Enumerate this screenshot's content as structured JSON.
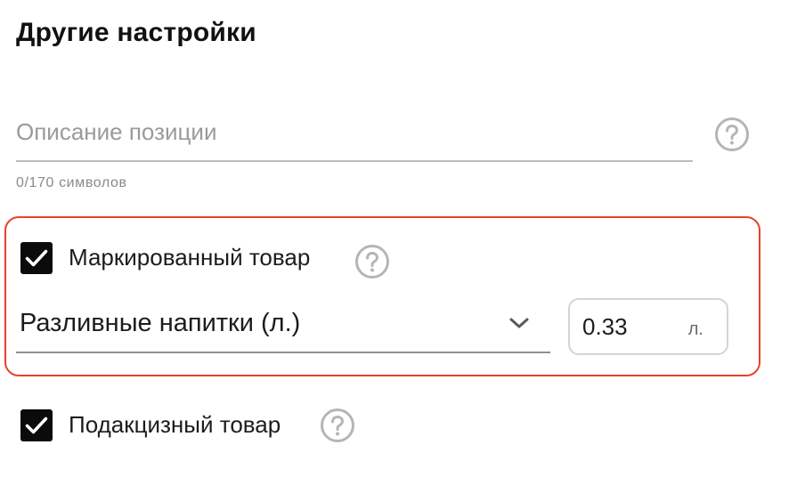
{
  "section": {
    "title": "Другие настройки"
  },
  "description": {
    "placeholder": "Описание позиции",
    "value": "",
    "counter": "0/170 символов",
    "help_icon": "question-circle-icon"
  },
  "marked_product": {
    "checked": true,
    "label": "Маркированный товар",
    "help_icon": "question-circle-icon",
    "highlight_color": "#e8412c",
    "category_select": {
      "selected": "Разливные напитки (л.)",
      "icon": "chevron-down-icon"
    },
    "volume": {
      "value": "0.33",
      "unit": "л."
    }
  },
  "excise_product": {
    "checked": true,
    "label": "Подакцизный товар",
    "help_icon": "question-circle-icon"
  },
  "colors": {
    "checkbox_fill": "#0b0b0b",
    "help_icon": "#b5b5b5",
    "text_primary": "#1c1c1c",
    "text_muted": "#8a8a8a"
  }
}
